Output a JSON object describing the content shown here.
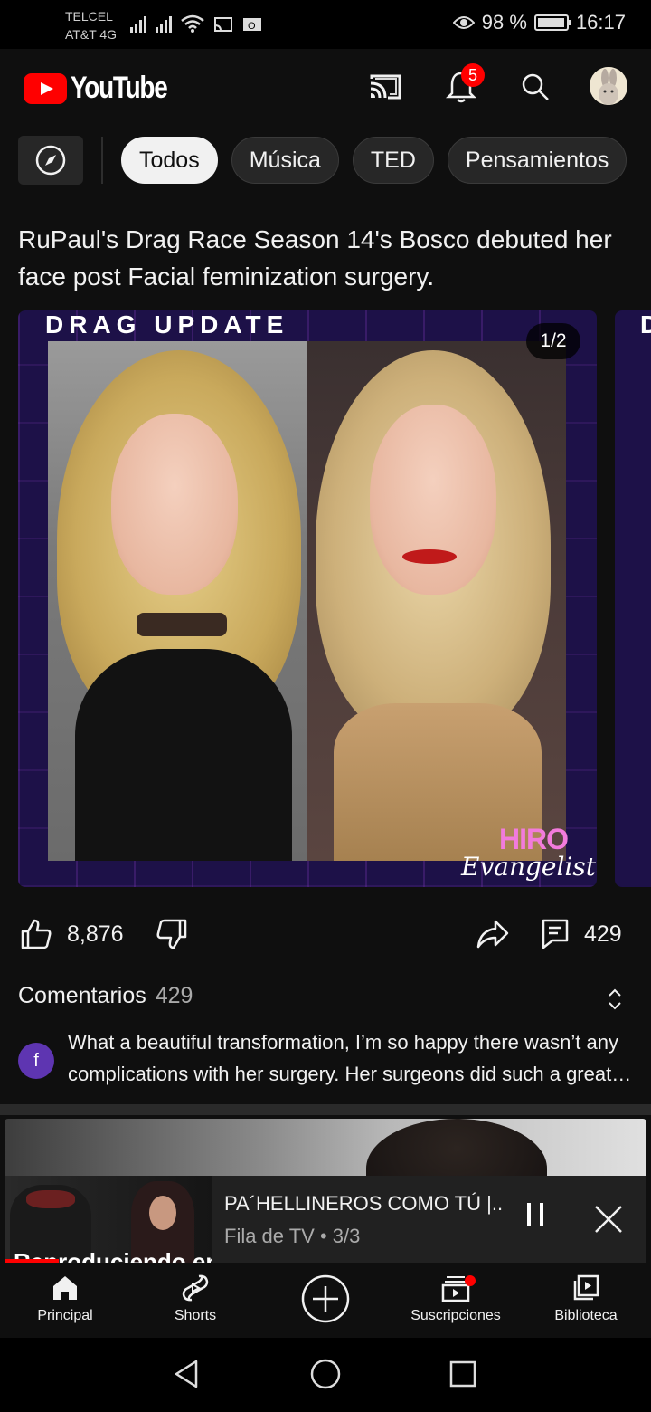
{
  "status_bar": {
    "carrier1": "TELCEL",
    "carrier2": "AT&T 4G",
    "battery_text": "98 %",
    "battery_level": 0.98,
    "time": "16:17"
  },
  "header": {
    "logo_text": "YouTube",
    "notification_count": "5"
  },
  "chips": {
    "explore_icon": "compass-icon",
    "items": [
      "Todos",
      "Música",
      "TED",
      "Pensamientos"
    ],
    "active": "Todos"
  },
  "post": {
    "title": "RuPaul's Drag Race Season 14's Bosco debuted her face post Facial feminization surgery.",
    "image_banner": "DRAG UPDATE",
    "image_counter": "1/2",
    "watermark_line1": "HIRO",
    "watermark_line2": "Evangelista",
    "next_card_letter": "D",
    "likes": "8,876",
    "comments_count": "429"
  },
  "comments": {
    "label": "Comentarios",
    "count": "429",
    "top_comment": {
      "avatar_letter": "f",
      "text": "What a beautiful transformation, I’m so happy there wasn’t any complications with her surgery. Her surgeons did such a great job"
    }
  },
  "miniplayer": {
    "title": "PA´HELLINEROS COMO TÚ |...",
    "subtitle": "Fila de TV • 3/3",
    "thumb_overlay": "Reproduciendo en",
    "progress": 0.26
  },
  "bottom_nav": {
    "items": [
      "Principal",
      "Shorts",
      "",
      "Suscripciones",
      "Biblioteca"
    ]
  },
  "colors": {
    "accent": "#ff0000",
    "background": "#0f0f0f",
    "chip_bg": "#272727",
    "card_purple": "#1d1148"
  }
}
